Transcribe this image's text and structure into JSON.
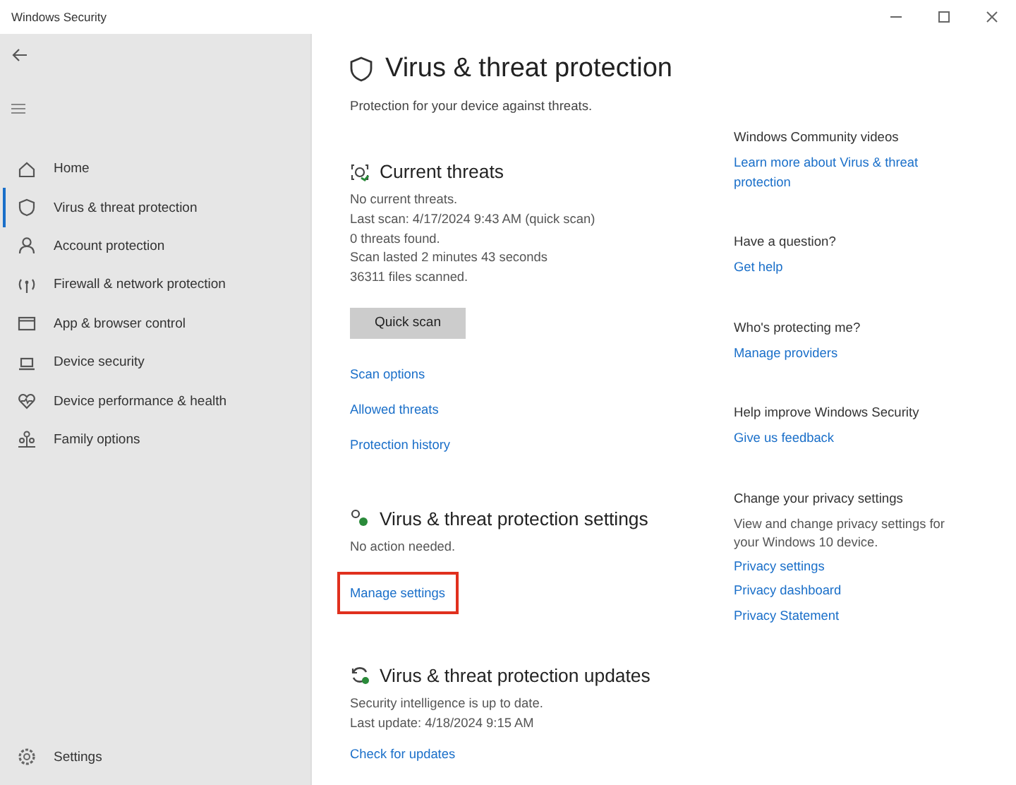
{
  "window": {
    "title": "Windows Security"
  },
  "sidebar": {
    "items": [
      {
        "label": "Home",
        "selected": false
      },
      {
        "label": "Virus & threat protection",
        "selected": true
      },
      {
        "label": "Account protection",
        "selected": false
      },
      {
        "label": "Firewall & network protection",
        "selected": false
      },
      {
        "label": "App & browser control",
        "selected": false
      },
      {
        "label": "Device security",
        "selected": false
      },
      {
        "label": "Device performance & health",
        "selected": false
      },
      {
        "label": "Family options",
        "selected": false
      }
    ],
    "settings": {
      "label": "Settings",
      "selected": false
    }
  },
  "page": {
    "title": "Virus & threat protection",
    "subtitle": "Protection for your device against threats.",
    "sections": [
      {
        "heading": "Current threats",
        "lines": [
          "No current threats.",
          "Last scan: 4/17/2024 9:43 AM (quick scan)",
          "0 threats found.",
          "Scan lasted 2 minutes 43 seconds",
          "36311 files scanned."
        ],
        "button": "Quick scan",
        "links": [
          {
            "label": "Scan options",
            "highlighted": false
          },
          {
            "label": "Allowed threats",
            "highlighted": false
          },
          {
            "label": "Protection history",
            "highlighted": false
          }
        ]
      },
      {
        "heading": "Virus & threat protection settings",
        "lines": [
          "No action needed."
        ],
        "links": [
          {
            "label": "Manage settings",
            "highlighted": true
          }
        ]
      },
      {
        "heading": "Virus & threat protection updates",
        "lines": [
          "Security intelligence is up to date.",
          "Last update: 4/18/2024 9:15 AM"
        ],
        "links": [
          {
            "label": "Check for updates",
            "highlighted": false
          }
        ]
      }
    ]
  },
  "aside": [
    {
      "heading": "Windows Community videos",
      "links": [
        "Learn more about Virus & threat protection"
      ]
    },
    {
      "heading": "Have a question?",
      "links": [
        "Get help"
      ]
    },
    {
      "heading": "Who's protecting me?",
      "links": [
        "Manage providers"
      ]
    },
    {
      "heading": "Help improve Windows Security",
      "links": [
        "Give us feedback"
      ]
    },
    {
      "heading": "Change your privacy settings",
      "text": "View and change privacy settings for your Windows 10 device.",
      "links": [
        "Privacy settings",
        "Privacy dashboard",
        "Privacy Statement"
      ]
    }
  ]
}
